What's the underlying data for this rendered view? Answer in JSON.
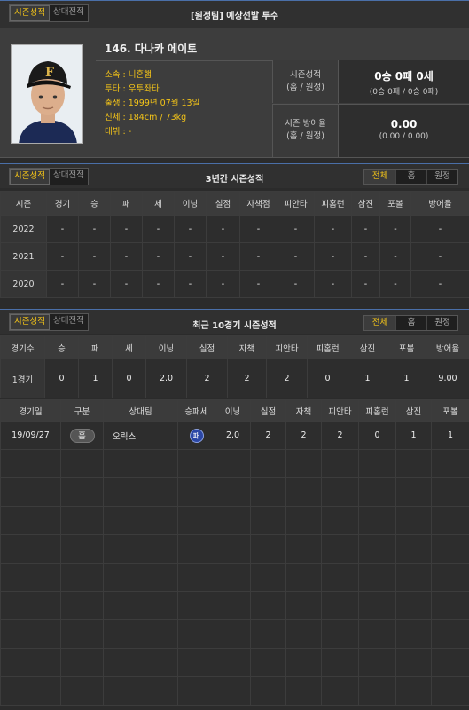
{
  "top_bar": {
    "toggle": [
      "시즌성적",
      "상대전적"
    ],
    "title": "[원정팀] 예상선발 투수"
  },
  "player": {
    "name": "146. 다나카 에이토",
    "info": [
      "소속 : 니혼햄",
      "투타 : 우투좌타",
      "출생 : 1999년 07월 13일",
      "신체 : 184cm / 73kg",
      "데뷔 : -"
    ],
    "season_record_label": [
      "시즌성적",
      "(홈 / 원정)"
    ],
    "season_record_value": "0승 0패 0세",
    "season_record_sub": "(0승 0패 / 0승 0패)",
    "era_label": [
      "시즌 방어율",
      "(홈 / 원정)"
    ],
    "era_value": "0.00",
    "era_sub": "(0.00 / 0.00)"
  },
  "three_year": {
    "toggle": [
      "시즌성적",
      "상대전적"
    ],
    "title": "3년간 시즌성적",
    "filters": [
      "전체",
      "홈",
      "원정"
    ],
    "headers": [
      "시즌",
      "경기",
      "승",
      "패",
      "세",
      "이닝",
      "실점",
      "자책점",
      "피안타",
      "피홈런",
      "삼진",
      "포볼",
      "방어율"
    ],
    "rows": [
      [
        "2022",
        "-",
        "-",
        "-",
        "-",
        "-",
        "-",
        "-",
        "-",
        "-",
        "-",
        "-",
        "-"
      ],
      [
        "2021",
        "-",
        "-",
        "-",
        "-",
        "-",
        "-",
        "-",
        "-",
        "-",
        "-",
        "-",
        "-"
      ],
      [
        "2020",
        "-",
        "-",
        "-",
        "-",
        "-",
        "-",
        "-",
        "-",
        "-",
        "-",
        "-",
        "-"
      ]
    ]
  },
  "recent10": {
    "toggle": [
      "시즌성적",
      "상대전적"
    ],
    "title": "최근 10경기 시즌성적",
    "filters": [
      "전체",
      "홈",
      "원정"
    ],
    "summary_headers": [
      "경기수",
      "승",
      "패",
      "세",
      "이닝",
      "실점",
      "자책",
      "피안타",
      "피홈런",
      "삼진",
      "포볼",
      "방어율"
    ],
    "summary_row": [
      "1경기",
      "0",
      "1",
      "0",
      "2.0",
      "2",
      "2",
      "2",
      "0",
      "1",
      "1",
      "9.00"
    ],
    "game_headers": [
      "경기일",
      "구분",
      "상대팀",
      "승패세",
      "이닝",
      "실점",
      "자책",
      "피안타",
      "피홈런",
      "삼진",
      "포볼"
    ],
    "games": [
      [
        "19/09/27",
        "홈",
        "오릭스",
        "패",
        "2.0",
        "2",
        "2",
        "2",
        "0",
        "1",
        "1"
      ]
    ]
  },
  "colors": {
    "accent": "#f5c518",
    "loss_badge": "#2b47a6",
    "border_top": "#4a6fa8"
  }
}
